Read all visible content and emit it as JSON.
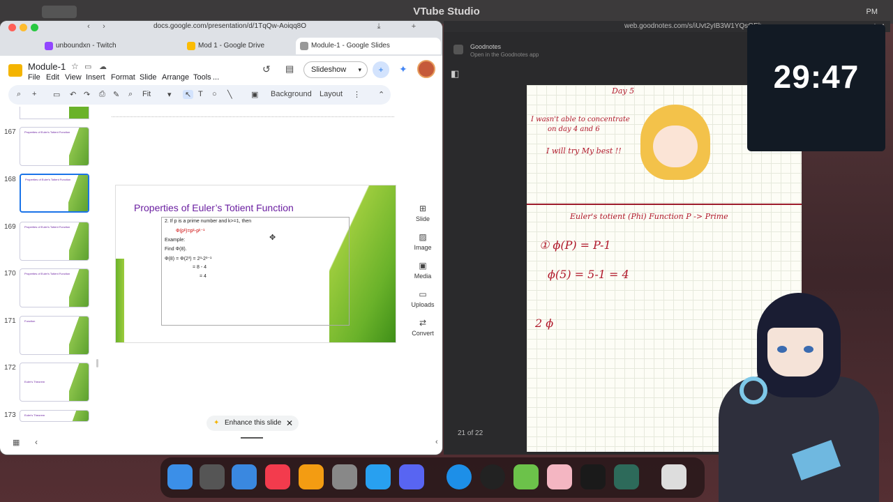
{
  "app_title": "VTube Studio",
  "clock_fragment": "PM",
  "browser": {
    "url": "docs.google.com/presentation/d/1TqQw-Aoiqq8O",
    "tabs": [
      {
        "label": "unboundxn - Twitch",
        "color": "#9146ff"
      },
      {
        "label": "Mod 1 - Google Drive",
        "color": "#fbbc04"
      },
      {
        "label": "Module-1 - Google Slides",
        "color": "#f4b400"
      }
    ]
  },
  "slides_app": {
    "doc_name": "Module-1",
    "menu": [
      "File",
      "Edit",
      "View",
      "Insert",
      "Format",
      "Slide",
      "Arrange",
      "Tools",
      "..."
    ],
    "slideshow_label": "Slideshow",
    "toolbar": {
      "zoom": "Fit",
      "background": "Background",
      "layout": "Layout"
    },
    "thumbnails": [
      {
        "num": "167",
        "title": "Properties of Euler's Totient Function"
      },
      {
        "num": "168",
        "title": "Properties of Euler's Totient Function",
        "selected": true
      },
      {
        "num": "169",
        "title": "Properties of Euler's Totient Function"
      },
      {
        "num": "170",
        "title": "Properties of Euler's Totient Function"
      },
      {
        "num": "171",
        "title": "Function"
      },
      {
        "num": "172",
        "title": "Euler's Theorem"
      },
      {
        "num": "173",
        "title": "Euler's Theorem"
      }
    ],
    "slide": {
      "title": "Properties of Euler’s Totient Function",
      "lines": [
        "2. If p is a prime number and k>=1, then",
        "Φ(pᵏ)=pᵏ-pᵏ⁻¹",
        "Example:",
        "Find Φ(8).",
        "Φ(8) = Φ(2³) = 2³-2³⁻¹",
        "= 8 - 4",
        "= 4"
      ]
    },
    "right_panel": [
      {
        "label": "Slide",
        "icon": "slide-icon"
      },
      {
        "label": "Image",
        "icon": "image-icon"
      },
      {
        "label": "Media",
        "icon": "media-icon"
      },
      {
        "label": "Uploads",
        "icon": "folder-icon"
      },
      {
        "label": "Convert",
        "icon": "convert-icon"
      }
    ],
    "enhance_label": "Enhance this slide"
  },
  "goodnotes": {
    "url": "web.goodnotes.com/s/iUvt2yIB3W1YQsQEh",
    "app_name": "Goodnotes",
    "app_sub": "Open in the Goodnotes app",
    "page_count": "21 of 22",
    "notes": {
      "day": "Day 5",
      "line1": "I wasn't able to concentrate",
      "line2": "on day 4 and 6",
      "line3": "I will try My best !!",
      "heading": "Euler's totient (Phi) Function   P -> Prime",
      "eq1": "① ϕ(P) = P-1",
      "eq2": "ϕ(5) = 5-1 = 4",
      "eq3": "2 ϕ"
    }
  },
  "timer": "29:47",
  "dock_apps": [
    "finder",
    "launchpad",
    "mail",
    "music",
    "pages",
    "settings",
    "altstore",
    "discord",
    "safari",
    "obs",
    "script-editor",
    "petal",
    "activity-monitor",
    "dictionary",
    "downloads"
  ]
}
